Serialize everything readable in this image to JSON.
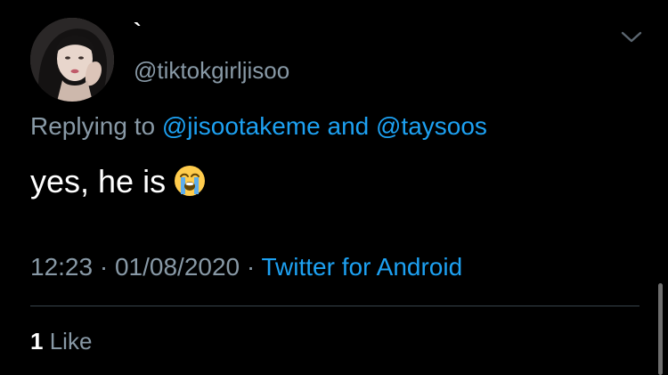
{
  "tweet": {
    "display_name": "`",
    "handle": "@tiktokgirljisoo",
    "replying_prefix": "Replying to",
    "reply_mention_1": "@jisootakeme",
    "reply_connector": "and",
    "reply_mention_2": "@taysoos",
    "text": "yes, he is",
    "emoji": "loudly-crying-face",
    "time": "12:23",
    "date": "01/08/2020",
    "separator": "·",
    "source": "Twitter for Android",
    "like_count": "1",
    "like_label": "Like",
    "menu_icon": "chevron-down-icon"
  },
  "colors": {
    "background": "#000000",
    "text": "#ffffff",
    "muted": "#8899a6",
    "link": "#1da1f2",
    "divider": "#38444d"
  }
}
